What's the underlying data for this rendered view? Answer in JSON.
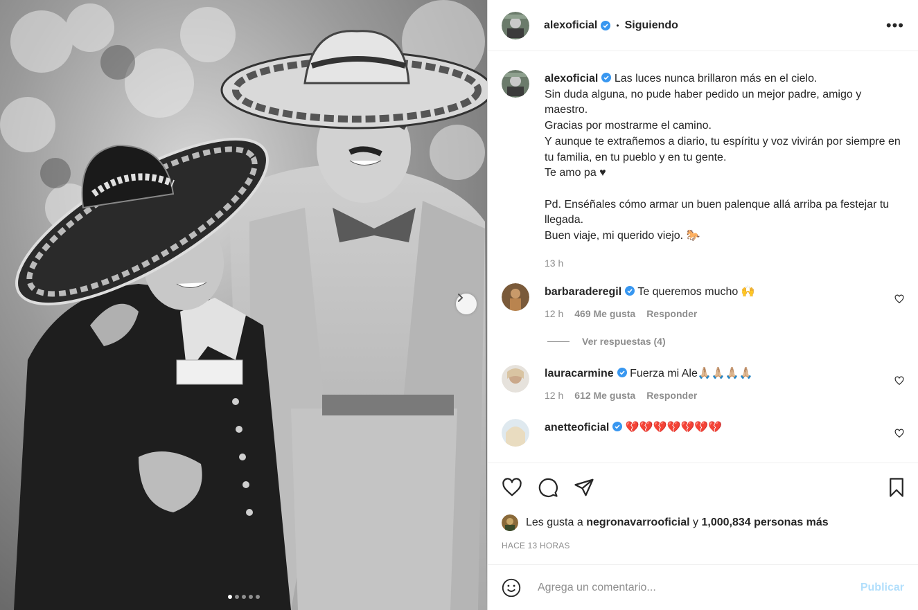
{
  "post": {
    "username": "alexoficial",
    "follow_status": "Siguiendo",
    "separator": "•",
    "more_label": "•••",
    "caption_username": "alexoficial",
    "caption_lines": [
      "Las luces nunca brillaron más en el cielo.",
      "Sin duda alguna, no pude haber pedido un mejor padre, amigo y maestro.",
      "Gracias por mostrarme el camino.",
      "Y aunque te extrañemos a diario, tu espíritu y voz vivirán por siempre en tu familia, en tu pueblo y en tu gente.",
      "Te amo pa ♥",
      "",
      "Pd. Enséñales cómo armar un buen palenque allá arriba pa festejar tu llegada.",
      "Buen viaje, mi querido viejo. 🐎"
    ],
    "caption_time": "13 h"
  },
  "comments": [
    {
      "username": "barbaraderegil",
      "text": "Te queremos mucho 🙌",
      "time": "12 h",
      "likes": "469 Me gusta",
      "reply_label": "Responder",
      "view_replies": "Ver respuestas (4)"
    },
    {
      "username": "lauracarmine",
      "text": "Fuerza mi Ale🙏🏼🙏🏼🙏🏼🙏🏼",
      "time": "12 h",
      "likes": "612 Me gusta",
      "reply_label": "Responder"
    },
    {
      "username": "anetteoficial",
      "text": "💔💔💔💔💔💔💔"
    }
  ],
  "likes": {
    "prefix": "Les gusta a",
    "liker": "negronavarrooficial",
    "joiner": "y",
    "count_text": "1,000,834 personas más"
  },
  "posted": "HACE 13 HORAS",
  "composer": {
    "placeholder": "Agrega un comentario...",
    "publish_label": "Publicar"
  },
  "carousel": {
    "total": 5,
    "current": 1
  },
  "colors": {
    "verified": "#3897f0",
    "publish_disabled": "#b2dffc",
    "secondary_text": "#8e8e8e"
  }
}
